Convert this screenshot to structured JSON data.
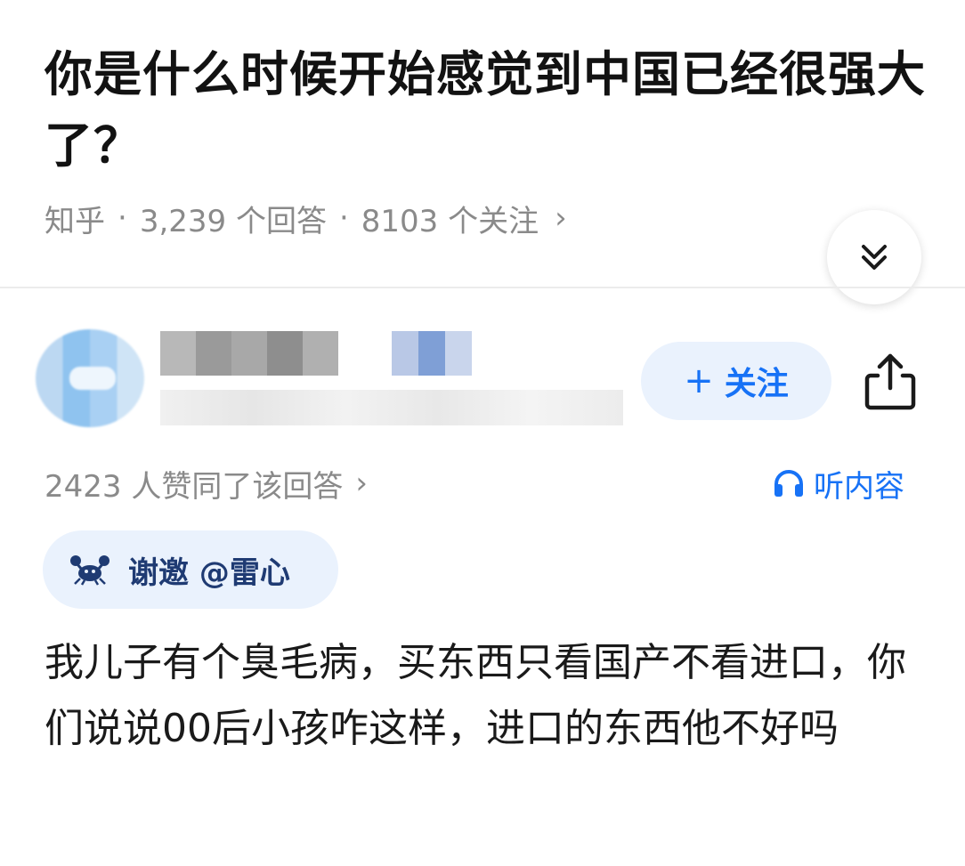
{
  "question": {
    "title": "你是什么时候开始感觉到中国已经很强大了？",
    "source": "知乎",
    "answer_count": "3,239 个回答",
    "follower_count": "8103 个关注",
    "chevron": "›"
  },
  "author": {
    "follow_label": "关注",
    "follow_plus": "+"
  },
  "answer": {
    "upvote_text": "2423 人赞同了该回答",
    "upvote_chevron": "›",
    "listen_label": "听内容",
    "invite_label": "谢邀 @雷心",
    "body": "我儿子有个臭毛病，买东西只看国产不看进口，你们说说00后小孩咋这样，进口的东西他不好吗"
  },
  "icons": {
    "collapse": "double-chevron-down-icon",
    "share": "share-icon",
    "headphones": "headphones-icon",
    "crab": "crab-icon"
  },
  "colors": {
    "accent": "#1772f6",
    "chip_bg": "#eaf2fd",
    "meta_gray": "#8a8a8a"
  }
}
